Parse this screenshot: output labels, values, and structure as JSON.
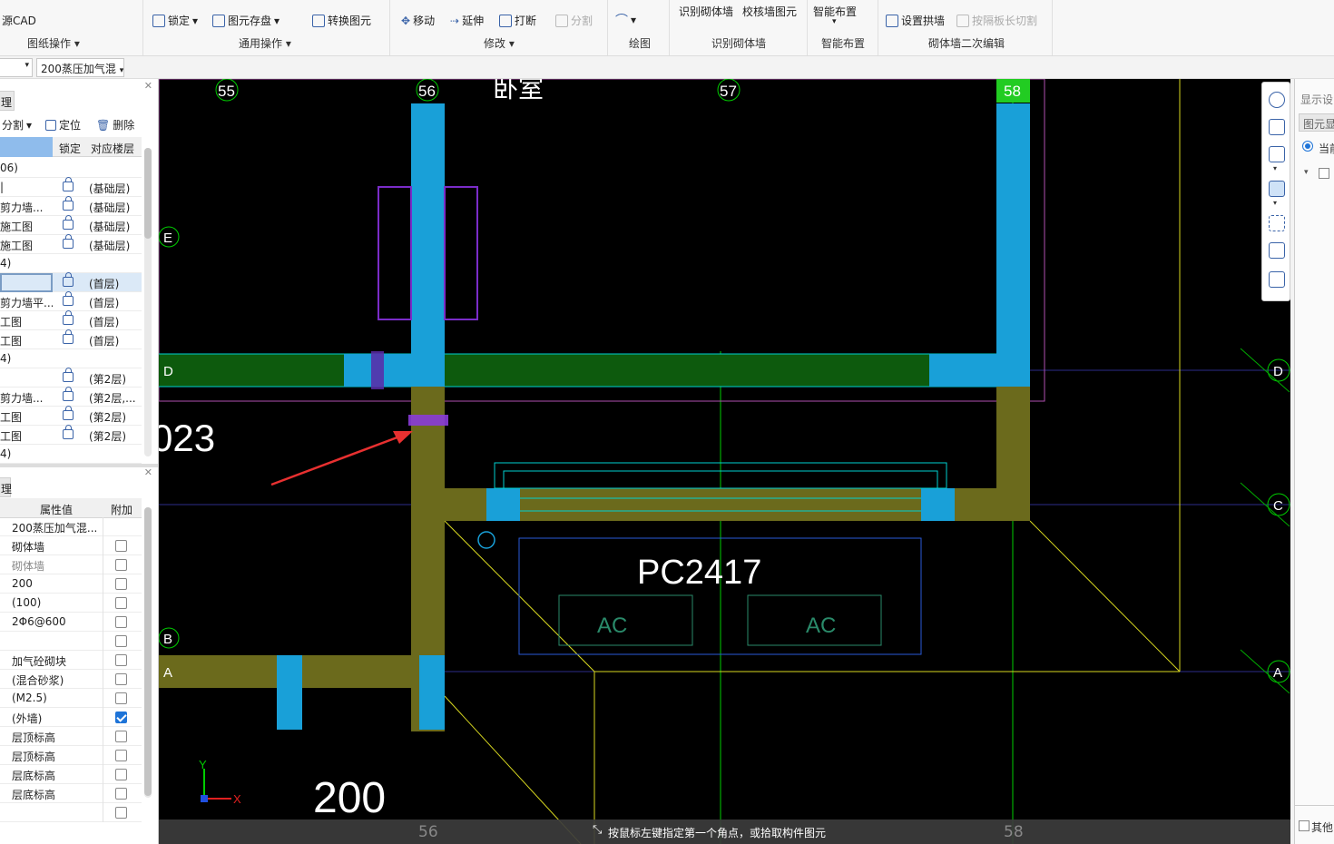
{
  "ribbon": {
    "drawing_ops": {
      "cad_source": "源CAD",
      "group_label": "图纸操作"
    },
    "common_ops": {
      "lock": "锁定",
      "save_element": "图元存盘",
      "convert_element": "转换图元",
      "group_label": "通用操作"
    },
    "modify": {
      "move": "移动",
      "extend": "延伸",
      "break": "打断",
      "split": "分割",
      "group_label": "修改"
    },
    "draw": {
      "group_label": "绘图"
    },
    "identify_wall": {
      "identify_masonry": "识别砌体墙",
      "check_wall": "校核墙图元",
      "group_label": "识别砌体墙"
    },
    "smart": {
      "smart_layout": "智能布置",
      "group_label": "智能布置"
    },
    "secondary_edit": {
      "set_arch_wall": "设置拱墙",
      "cut_by_length": "按隔板长切割",
      "group_label": "砌体墙二次编辑"
    }
  },
  "selector": {
    "component": "200蒸压加气混"
  },
  "layer_panel": {
    "tab": "理",
    "toolbar": {
      "split": "分割",
      "locate": "定位",
      "delete": "删除"
    },
    "columns": {
      "lock": "锁定",
      "floor": "对应楼层"
    },
    "rows": [
      {
        "name": "06)",
        "floor": "",
        "group": true
      },
      {
        "name": "|",
        "floor": "(基础层)"
      },
      {
        "name": "剪力墙...",
        "floor": "(基础层)"
      },
      {
        "name": "施工图",
        "floor": "(基础层)"
      },
      {
        "name": "施工图",
        "floor": "(基础层)"
      },
      {
        "name": "4)",
        "floor": "",
        "group": true
      },
      {
        "name": "",
        "floor": "(首层)",
        "selected": true
      },
      {
        "name": "剪力墙平...",
        "floor": "(首层)"
      },
      {
        "name": "工图",
        "floor": "(首层)"
      },
      {
        "name": "工图",
        "floor": "(首层)"
      },
      {
        "name": "4)",
        "floor": "",
        "group": true
      },
      {
        "name": "",
        "floor": "(第2层)"
      },
      {
        "name": "剪力墙...",
        "floor": "(第2层,..."
      },
      {
        "name": "工图",
        "floor": "(第2层)"
      },
      {
        "name": "工图",
        "floor": "(第2层)"
      },
      {
        "name": "4)",
        "floor": "",
        "group": true
      }
    ]
  },
  "property_panel": {
    "tab": "理",
    "columns": {
      "value": "属性值",
      "extra": "附加"
    },
    "rows": [
      {
        "value": "200蒸压加气混...",
        "check": null
      },
      {
        "value": "砌体墙",
        "check": false
      },
      {
        "value": "砌体墙",
        "check": false,
        "dim": true
      },
      {
        "value": "200",
        "check": false
      },
      {
        "value": "(100)",
        "check": false
      },
      {
        "value": "2Φ6@600",
        "check": false
      },
      {
        "value": "",
        "check": false
      },
      {
        "value": "加气砼砌块",
        "check": false
      },
      {
        "value": "(混合砂浆)",
        "check": false
      },
      {
        "value": "(M2.5)",
        "check": false
      },
      {
        "value": "(外墙)",
        "check": true
      },
      {
        "value": "层顶标高",
        "check": false
      },
      {
        "value": "层顶标高",
        "check": false
      },
      {
        "value": "层底标高",
        "check": false
      },
      {
        "value": "层底标高",
        "check": false
      },
      {
        "value": "",
        "check": false
      }
    ]
  },
  "canvas": {
    "axes_top": [
      "55",
      "56",
      "57",
      "58"
    ],
    "axes_side": [
      "E",
      "D",
      "C",
      "B",
      "A"
    ],
    "room_label": "卧室",
    "window_label": "PC2417",
    "ac_label": "AC",
    "dim_text_left": "023",
    "dim_text_bottom": "200",
    "bottom_axes": [
      "56",
      "58"
    ],
    "status_message": "按鼠标左键指定第一个角点，或拾取构件图元"
  },
  "right_panel": {
    "display_settings": "显示设",
    "element_display": "图元显",
    "current": "当前",
    "other": "其他"
  }
}
